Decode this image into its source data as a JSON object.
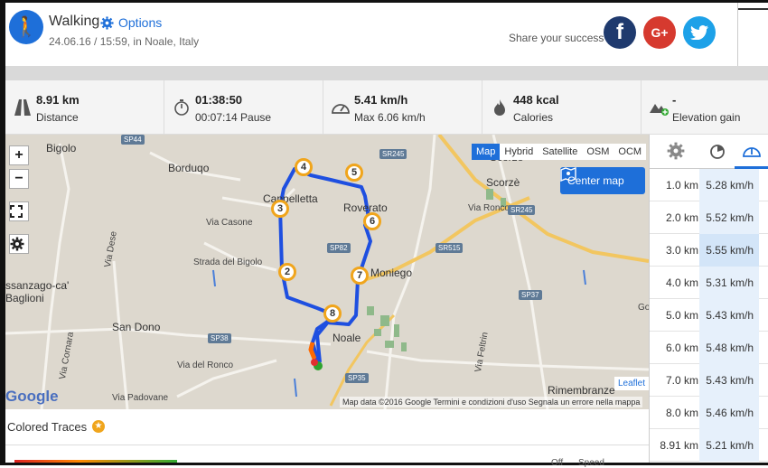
{
  "header": {
    "activity": "Walking",
    "options_label": "Options",
    "subtitle": "24.06.16 / 15:59, in Noale, Italy",
    "share_text": "Share your success",
    "social": {
      "facebook": "f",
      "googleplus": "G+",
      "twitter": "t"
    }
  },
  "stats": [
    {
      "icon": "road-icon",
      "value": "8.91 km",
      "label": "Distance"
    },
    {
      "icon": "stopwatch-icon",
      "value": "01:38:50",
      "label": "00:07:14 Pause"
    },
    {
      "icon": "speedometer-icon",
      "value": "5.41 km/h",
      "label": "Max 6.06 km/h"
    },
    {
      "icon": "flame-icon",
      "value": "448 kcal",
      "label": "Calories"
    },
    {
      "icon": "elevation-icon",
      "value": "-",
      "label": "Elevation gain"
    }
  ],
  "map": {
    "types": [
      "Map",
      "Hybrid",
      "Satellite",
      "OSM",
      "OCM"
    ],
    "active_type": "Map",
    "center_label": "Center map",
    "zoom_in": "+",
    "zoom_out": "−",
    "google": "Google",
    "leaflet": "Leaflet",
    "attribution": "Map data ©2016 Google    Termini e condizioni d'uso    Segnala un errore nella mappa",
    "places": [
      "Bigolo",
      "Borduqo",
      "Cappelletta",
      "Roverato",
      "Via Casone",
      "Strada del Bigolo",
      "San Dono",
      "Noale",
      "Moniego",
      "Scorzè",
      "Via Ronco",
      "Rimembranze",
      "Via Dese",
      "Via Cornara",
      "Via del Ronco",
      "Via Padovane",
      "Via Feltrin",
      "ssanzago-ca' Baglioni",
      "Scorze",
      "Golf"
    ],
    "roads": [
      "SP44",
      "SR245",
      "SP82",
      "SR515",
      "SP37",
      "SP38",
      "SP35",
      "SR245"
    ],
    "markers": [
      "2",
      "3",
      "4",
      "5",
      "6",
      "7",
      "8"
    ]
  },
  "splits": {
    "rows": [
      {
        "km": "1.0 km",
        "speed": "5.28 km/h"
      },
      {
        "km": "2.0 km",
        "speed": "5.52 km/h"
      },
      {
        "km": "3.0 km",
        "speed": "5.55 km/h"
      },
      {
        "km": "4.0 km",
        "speed": "5.31 km/h"
      },
      {
        "km": "5.0 km",
        "speed": "5.43 km/h"
      },
      {
        "km": "6.0 km",
        "speed": "5.48 km/h"
      },
      {
        "km": "7.0 km",
        "speed": "5.43 km/h"
      },
      {
        "km": "8.0 km",
        "speed": "5.46 km/h"
      },
      {
        "km": "8.91 km",
        "speed": "5.21 km/h"
      }
    ]
  },
  "traces": {
    "label": "Colored Traces",
    "off": "Off",
    "speed": "Speed"
  },
  "colors": {
    "accent": "#1e6fd9",
    "marker": "#f0a51c",
    "route": "#1e4fe0"
  }
}
